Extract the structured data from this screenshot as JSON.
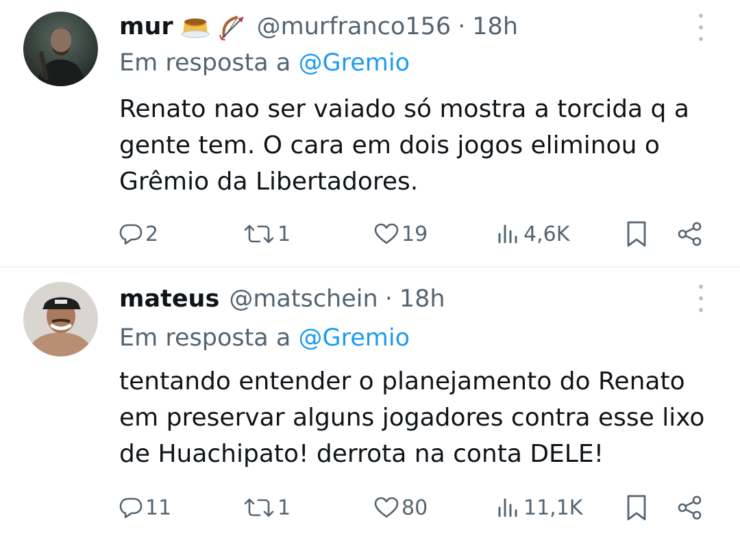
{
  "tweets": [
    {
      "name": "mur",
      "emojis": [
        "flan-pudding-emoji",
        "bow-and-arrow-emoji"
      ],
      "handle": "@murfranco156",
      "separator": "·",
      "time": "18h",
      "reply_prefix": "Em resposta a",
      "reply_to": "@Gremio",
      "text": "Renato nao ser vaiado só mostra a torcida q a gente tem. O cara em dois jogos eliminou o Grêmio da Libertadores.",
      "stats": {
        "replies": "2",
        "retweets": "1",
        "likes": "19",
        "views": "4,6K"
      }
    },
    {
      "name": "mateus",
      "emojis": [],
      "handle": "@matschein",
      "separator": "·",
      "time": "18h",
      "reply_prefix": "Em resposta a",
      "reply_to": "@Gremio",
      "text": "tentando entender o planejamento do Renato em preservar alguns jogadores contra esse lixo de Huachipato! derrota na conta DELE!",
      "stats": {
        "replies": "11",
        "retweets": "1",
        "likes": "80",
        "views": "11,1K"
      }
    }
  ],
  "colors": {
    "text": "#0f1419",
    "secondary": "#536471",
    "link": "#1d9bf0",
    "divider": "#eff3f4"
  },
  "icons": [
    "more-icon",
    "reply-icon",
    "retweet-icon",
    "like-icon",
    "views-icon",
    "bookmark-icon",
    "share-icon"
  ]
}
